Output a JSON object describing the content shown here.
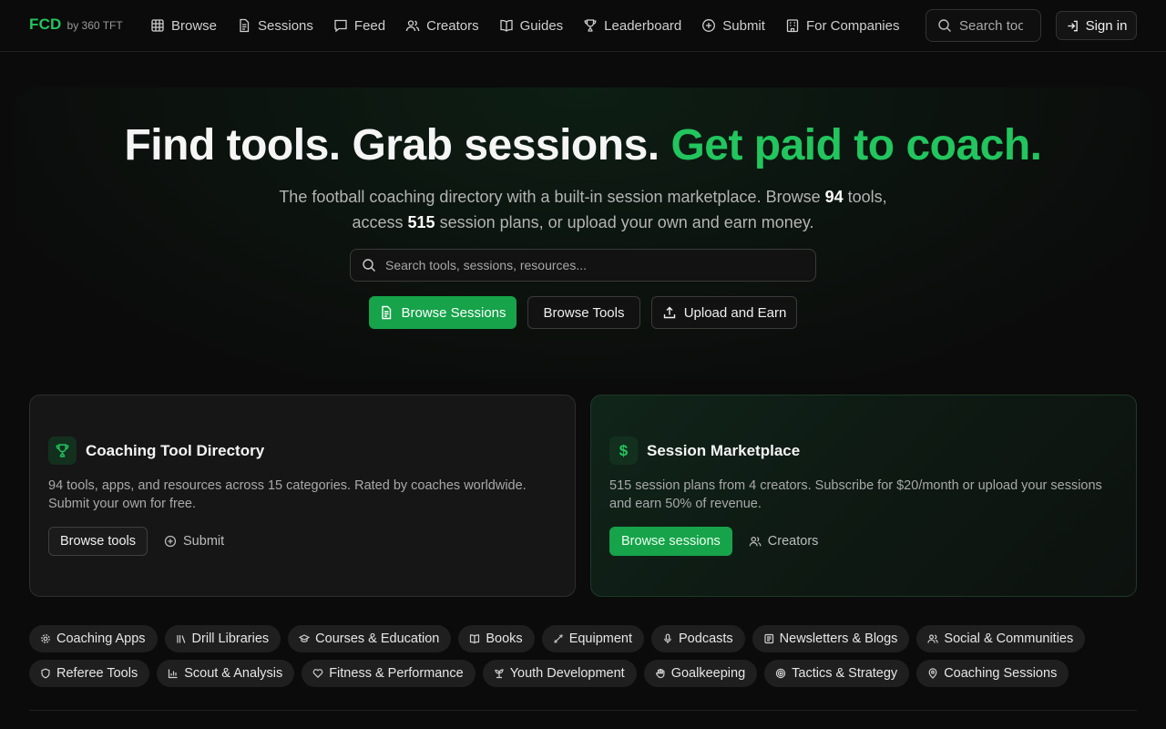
{
  "brand": {
    "logo": "FCD",
    "by": "by 360 TFT"
  },
  "nav": {
    "links": [
      {
        "label": "Browse",
        "icon": "grid-icon"
      },
      {
        "label": "Sessions",
        "icon": "document-icon"
      },
      {
        "label": "Feed",
        "icon": "chat-icon"
      },
      {
        "label": "Creators",
        "icon": "users-icon"
      },
      {
        "label": "Guides",
        "icon": "book-icon"
      },
      {
        "label": "Leaderboard",
        "icon": "trophy-icon"
      },
      {
        "label": "Submit",
        "icon": "plus-circle-icon"
      },
      {
        "label": "For Companies",
        "icon": "building-icon"
      }
    ],
    "search_placeholder": "Search tools...",
    "signin_label": "Sign in"
  },
  "hero": {
    "title_main": "Find tools. Grab sessions. ",
    "title_accent": "Get paid to coach.",
    "sub_part1": "The football coaching directory with a built-in session marketplace. Browse ",
    "tools_count": "94",
    "sub_part2": " tools, access ",
    "sessions_count": "515",
    "sub_part3": " session plans, or upload your own and earn money.",
    "search_placeholder": "Search tools, sessions, resources...",
    "btn_sessions": "Browse Sessions",
    "btn_tools": "Browse Tools",
    "btn_upload": "Upload and Earn"
  },
  "cards": {
    "directory": {
      "title": "Coaching Tool Directory",
      "desc": "94 tools, apps, and resources across 15 categories. Rated by coaches worldwide. Submit your own for free.",
      "primary": "Browse tools",
      "secondary": "Submit"
    },
    "marketplace": {
      "icon_glyph": "$",
      "title": "Session Marketplace",
      "desc": "515 session plans from 4 creators. Subscribe for $20/month or upload your sessions and earn 50% of revenue.",
      "primary": "Browse sessions",
      "secondary": "Creators"
    }
  },
  "categories": [
    {
      "label": "Coaching Apps",
      "icon": "gear-icon"
    },
    {
      "label": "Drill Libraries",
      "icon": "library-icon"
    },
    {
      "label": "Courses & Education",
      "icon": "graduation-cap-icon"
    },
    {
      "label": "Books",
      "icon": "book-icon"
    },
    {
      "label": "Equipment",
      "icon": "dumbbell-icon"
    },
    {
      "label": "Podcasts",
      "icon": "mic-icon"
    },
    {
      "label": "Newsletters & Blogs",
      "icon": "newspaper-icon"
    },
    {
      "label": "Social & Communities",
      "icon": "users-icon"
    },
    {
      "label": "Referee Tools",
      "icon": "shield-icon"
    },
    {
      "label": "Scout & Analysis",
      "icon": "bar-chart-icon"
    },
    {
      "label": "Fitness & Performance",
      "icon": "heart-icon"
    },
    {
      "label": "Youth Development",
      "icon": "sprout-icon"
    },
    {
      "label": "Goalkeeping",
      "icon": "hand-icon"
    },
    {
      "label": "Tactics & Strategy",
      "icon": "target-icon"
    },
    {
      "label": "Coaching Sessions",
      "icon": "map-pin-icon"
    }
  ],
  "colors": {
    "accent": "#22c55e",
    "accent_button": "#16a34a",
    "background": "#0b0b0b"
  }
}
